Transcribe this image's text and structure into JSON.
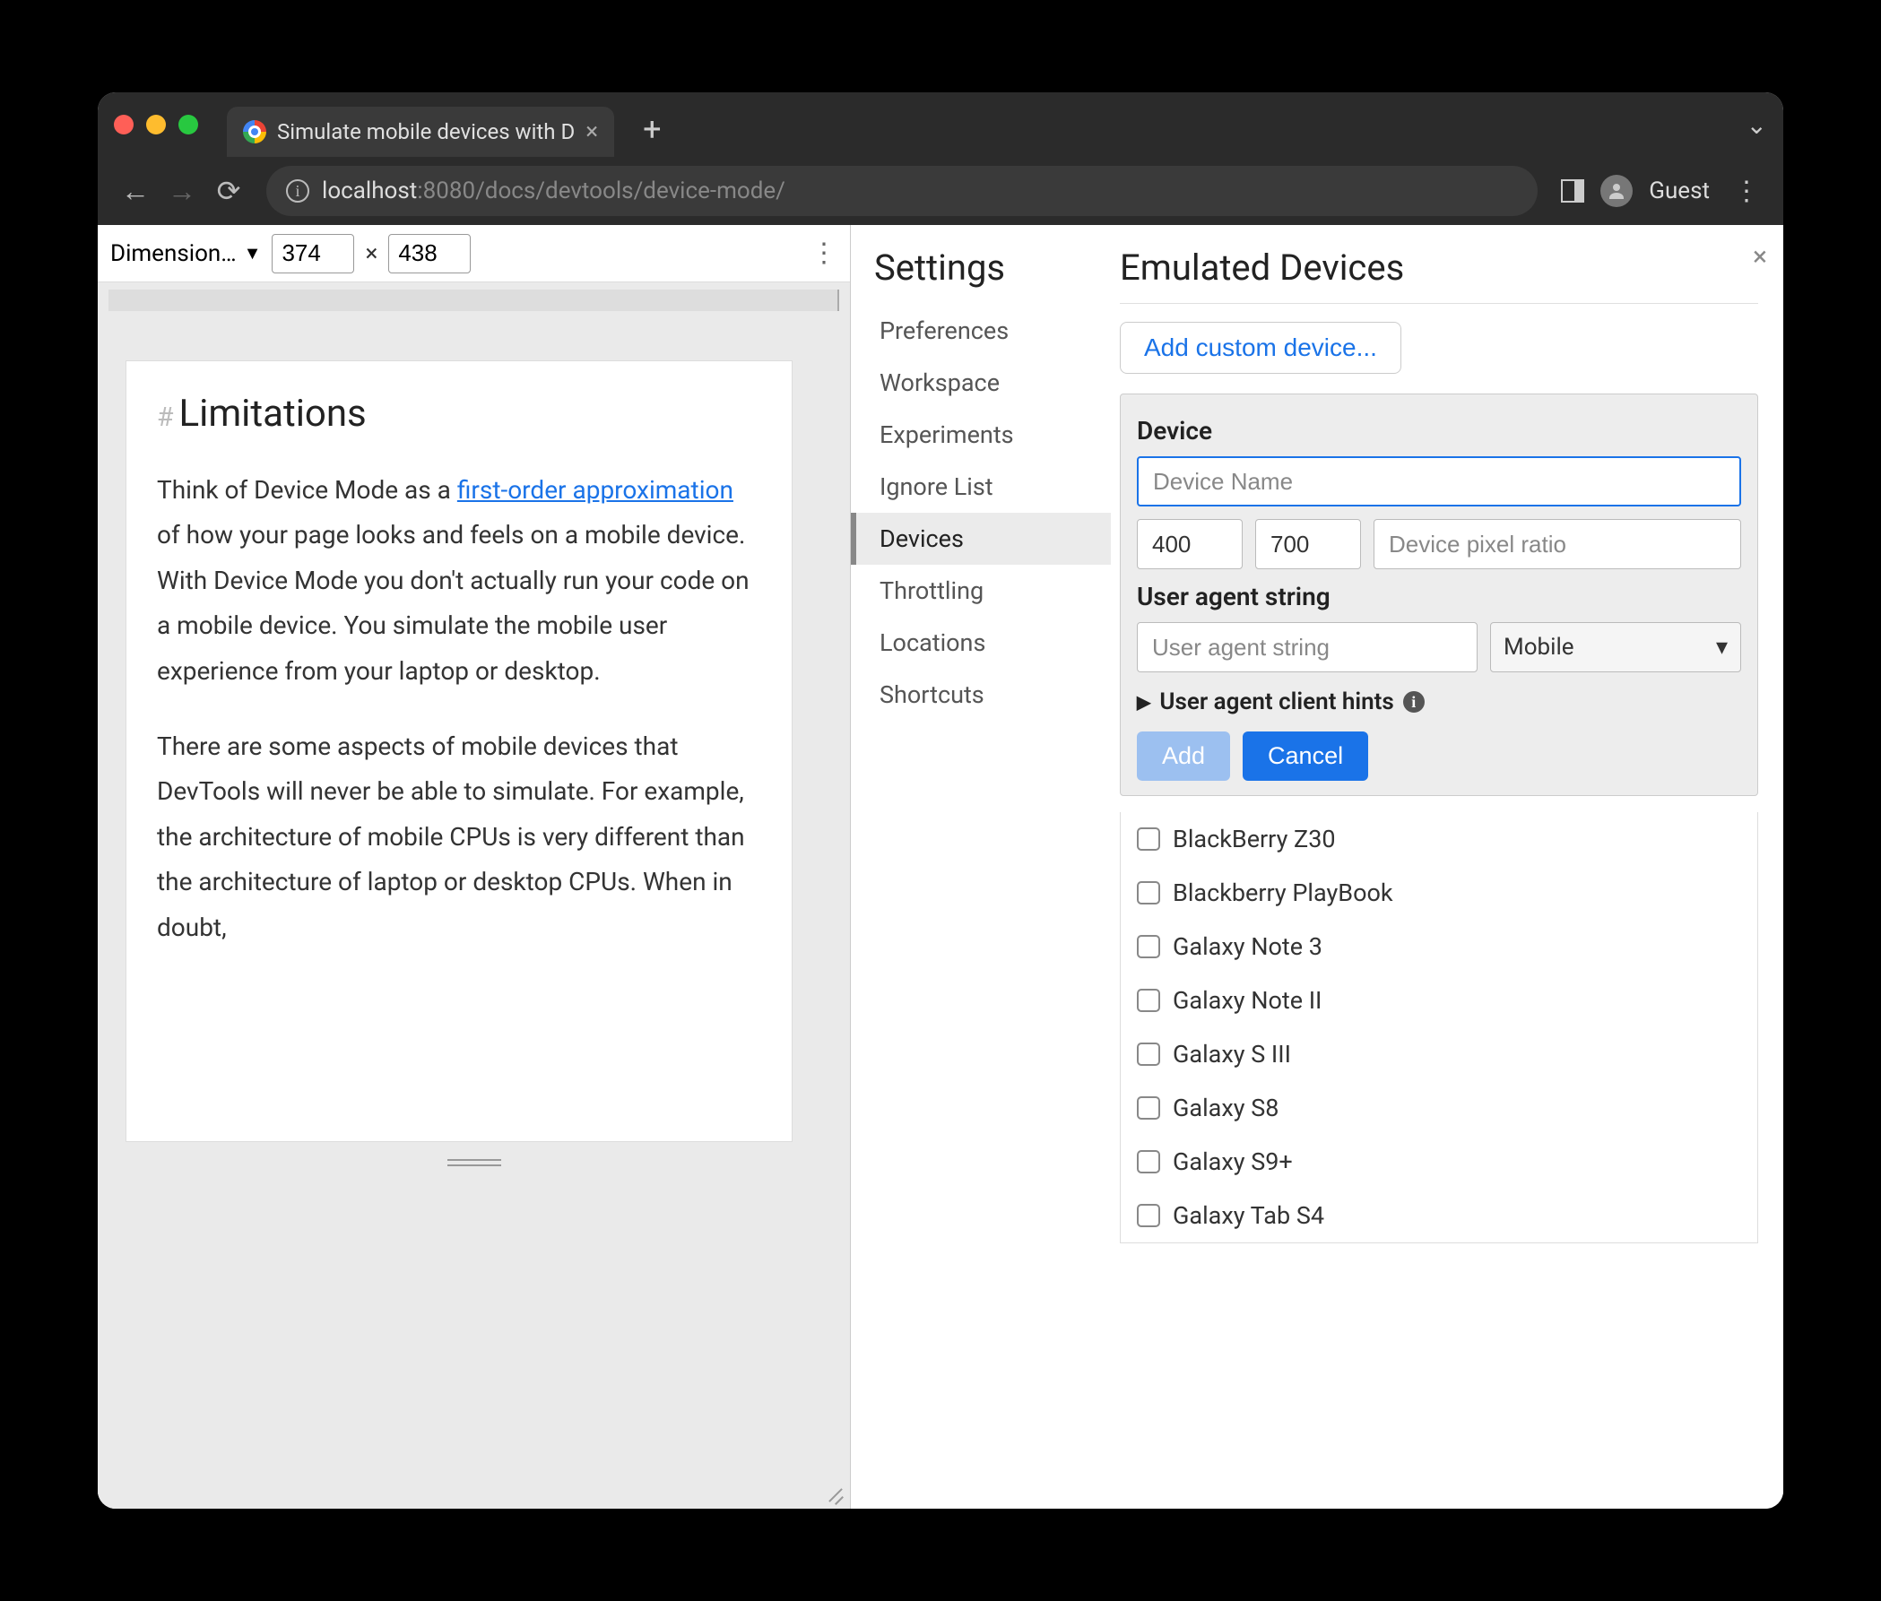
{
  "browser": {
    "tab_title": "Simulate mobile devices with D",
    "url_host": "localhost",
    "url_port": ":8080",
    "url_path": "/docs/devtools/device-mode/",
    "guest_label": "Guest"
  },
  "device_mode": {
    "dimensions_label": "Dimension…",
    "width": "374",
    "height": "438"
  },
  "article": {
    "heading": "Limitations",
    "p1_a": "Think of Device Mode as a ",
    "p1_link": "first-order approximation",
    "p1_b": " of how your page looks and feels on a mobile device. With Device Mode you don't actually run your code on a mobile device. You simulate the mobile user experience from your laptop or desktop.",
    "p2": "There are some aspects of mobile devices that DevTools will never be able to simulate. For example, the architecture of mobile CPUs is very different than the architecture of laptop or desktop CPUs. When in doubt,"
  },
  "settings": {
    "title": "Settings",
    "items": [
      "Preferences",
      "Workspace",
      "Experiments",
      "Ignore List",
      "Devices",
      "Throttling",
      "Locations",
      "Shortcuts"
    ],
    "active_index": 4
  },
  "emulated": {
    "title": "Emulated Devices",
    "add_custom": "Add custom device...",
    "device_label": "Device",
    "device_name_placeholder": "Device Name",
    "width_value": "400",
    "height_value": "700",
    "dpr_placeholder": "Device pixel ratio",
    "ua_label": "User agent string",
    "ua_placeholder": "User agent string",
    "ua_type": "Mobile",
    "hints_label": "User agent client hints",
    "add_btn": "Add",
    "cancel_btn": "Cancel",
    "devices": [
      "BlackBerry Z30",
      "Blackberry PlayBook",
      "Galaxy Note 3",
      "Galaxy Note II",
      "Galaxy S III",
      "Galaxy S8",
      "Galaxy S9+",
      "Galaxy Tab S4"
    ]
  }
}
